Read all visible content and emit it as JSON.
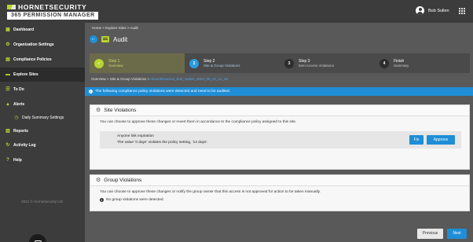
{
  "app": {
    "brand_name": "HORNETSECURITY",
    "brand_product": "365 PERMISSION MANAGER",
    "user_name": "Bob Sullen",
    "colors": {
      "accent": "#b8d430",
      "primary": "#1f8ed6",
      "sidebar": "#3c3c3c"
    }
  },
  "sidebar": {
    "items": [
      {
        "label": "Dashboard",
        "icon": "dashboard-icon"
      },
      {
        "label": "Organization Settings",
        "icon": "settings-icon"
      },
      {
        "label": "Compliance Policies",
        "icon": "policy-icon"
      },
      {
        "label": "Explore Sites",
        "icon": "folder-icon",
        "active": true
      },
      {
        "label": "To Do",
        "icon": "todo-icon"
      },
      {
        "label": "Alerts",
        "icon": "alert-icon",
        "expanded": true
      },
      {
        "label": "Daily Summary Settings",
        "icon": "clock-icon"
      },
      {
        "label": "Reports",
        "icon": "reports-icon"
      },
      {
        "label": "Activity Log",
        "icon": "activity-icon"
      },
      {
        "label": "Help",
        "icon": "help-icon"
      }
    ],
    "footer": "2021 © Hornetsecurity Ltd."
  },
  "main": {
    "breadcrumb": "Home > Explore Sites > Audit",
    "title": "Audit",
    "steps": [
      {
        "num": "",
        "label": "Step 1",
        "sub": "Overview",
        "state": "done"
      },
      {
        "num": "2",
        "label": "Step 2",
        "sub": "Site & Group Violations",
        "state": "current"
      },
      {
        "num": "3",
        "label": "Step 3",
        "sub": "Item Access Violations",
        "state": "todo"
      },
      {
        "num": "4",
        "label": "Finish",
        "sub": "Summary",
        "state": "todo"
      }
    ],
    "subcrumb_prefix": "Overview > Site & Group Violations >",
    "subcrumb_site": "AllandRestored_Bob_Sullen_2022_09_21_21_26",
    "alert": "The following compliance policy violations were detected and need to be audited.",
    "site_violations": {
      "title": "Site Violations",
      "description": "You can choose to approve these changes or revert them in accordance to the compliance policy assigned to this site.",
      "item_title": "Anyone link expiration",
      "item_detail": "The value '0 days' violates the policy setting, '14 days'.",
      "fix_label": "Fix",
      "approve_label": "Approve"
    },
    "group_violations": {
      "title": "Group Violations",
      "description": "You can choose to approve these changes or notify the group owner that this access is not approved for action to be taken manually.",
      "empty": "No group violations were detected."
    },
    "previous_label": "Previous",
    "next_label": "Next"
  }
}
